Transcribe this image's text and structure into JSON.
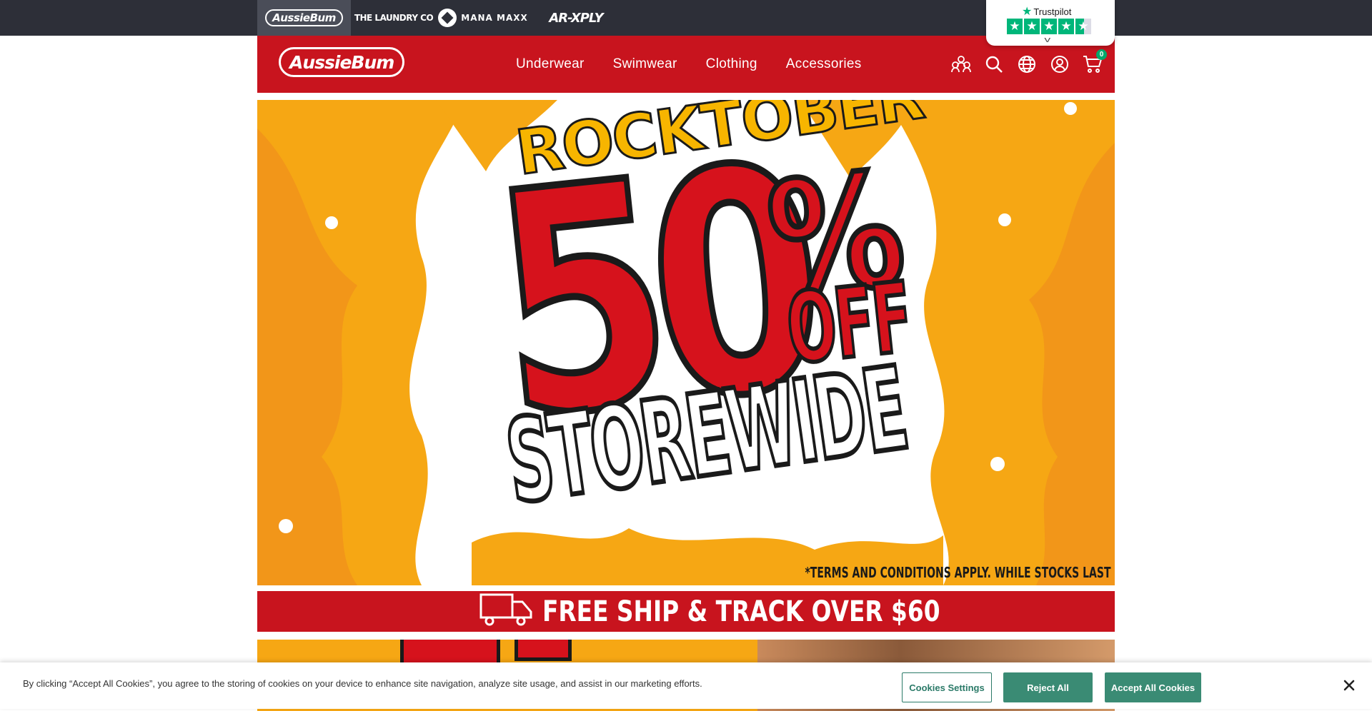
{
  "brands": {
    "tabs": [
      {
        "label": "AussieBum",
        "active": true
      },
      {
        "label": "THE LAUNDRY CO",
        "active": false
      },
      {
        "label": "MANA MAXX",
        "active": false
      },
      {
        "label": "AR-XPLY",
        "active": false
      }
    ]
  },
  "trustpilot": {
    "label": "Trustpilot",
    "stars": 4.5
  },
  "header": {
    "logo_text": "AussieBum",
    "nav": [
      "Underwear",
      "Swimwear",
      "Clothing",
      "Accessories"
    ],
    "icons": [
      "community-icon",
      "search-icon",
      "globe-icon",
      "account-icon",
      "cart-icon"
    ],
    "cart_count": "0"
  },
  "hero": {
    "eyebrow": "ROCKTOBER",
    "big_number": "50",
    "percent": "%",
    "off": "OFF",
    "storewide": "STOREWIDE",
    "terms": "*TERMS AND CONDITIONS APPLY. WHILE STOCKS LAST"
  },
  "shipping": {
    "text": "FREE SHIP & TRACK OVER $60"
  },
  "cookies": {
    "message": "By clicking “Accept All Cookies”, you agree to the storing of cookies on your device to enhance site navigation, analyze site usage, and assist in our marketing efforts.",
    "settings_label": "Cookies Settings",
    "reject_label": "Reject All",
    "accept_label": "Accept All Cookies"
  },
  "colors": {
    "brand_red": "#c8141e",
    "top_bar": "#2d2f38",
    "cookie_green": "#3a8b74",
    "trustpilot_green": "#00b67a"
  }
}
